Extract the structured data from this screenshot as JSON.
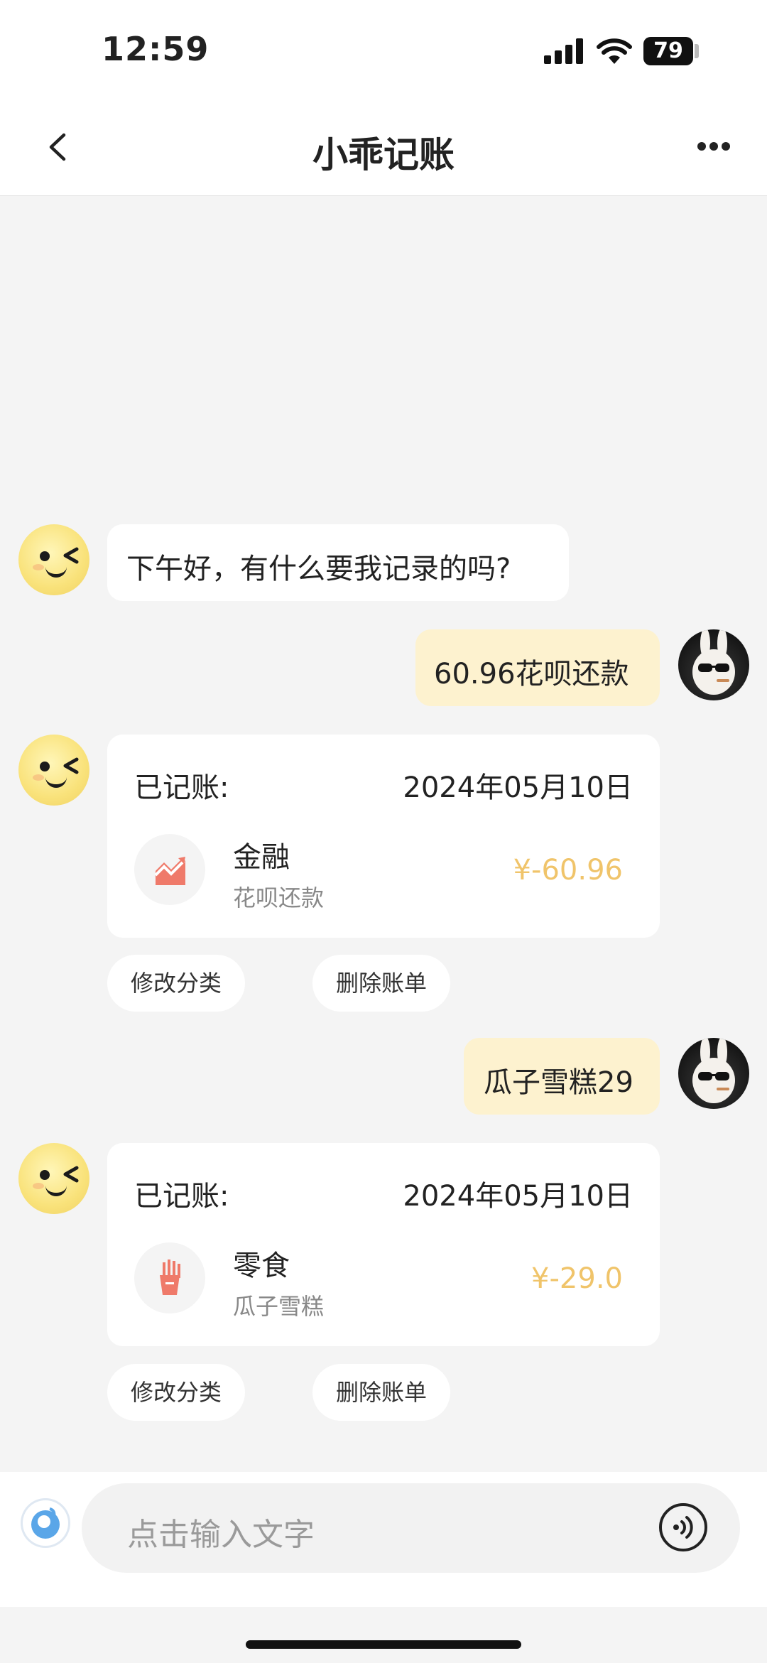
{
  "status": {
    "time": "12:59",
    "battery": "79"
  },
  "nav": {
    "title": "小乖记账"
  },
  "messages": {
    "greeting": "下午好，有什么要我记录的吗?",
    "user1": "60.96花呗还款",
    "user2": "瓜子雪糕29"
  },
  "records": [
    {
      "label": "已记账:",
      "date": "2024年05月10日",
      "category": "金融",
      "note": "花呗还款",
      "amount": "¥-60.96",
      "icon": "finance-chart-icon"
    },
    {
      "label": "已记账:",
      "date": "2024年05月10日",
      "category": "零食",
      "note": "瓜子雪糕",
      "amount": "¥-29.0",
      "icon": "fries-icon"
    }
  ],
  "actions": {
    "edit_category": "修改分类",
    "delete_bill": "删除账单"
  },
  "input": {
    "placeholder": "点击输入文字"
  },
  "colors": {
    "amount": "#f0c46a",
    "user_bubble": "#fdf2cf",
    "background": "#f4f4f4"
  }
}
